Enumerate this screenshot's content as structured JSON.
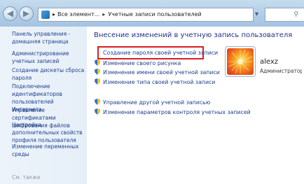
{
  "address_bar": {
    "crumbs": [
      "Все элемент...",
      "Учетные записи пользователей"
    ],
    "separator": "▸"
  },
  "left_nav": {
    "home": "Панель управления - домашняя страница",
    "links": [
      "Администрирование учетных записей",
      "Создание дискеты сброса пароля",
      "Подключение идентификаторов пользователей Интернета",
      "Управление сертификатами шифрования файлов",
      "Настройка дополнительных свойств профиля пользователя",
      "Изменение переменных среды"
    ],
    "see_also": "См. также"
  },
  "main": {
    "heading": "Внесение изменений в учетную запись пользователя",
    "tasks": [
      "Создание пароля своей учетной записи",
      "Изменение своего рисунка",
      "Изменение имени своей учетной записи",
      "Изменение типа своей учетной записи",
      "Управление другой учетной записью",
      "Изменение параметров контроля учетных записей"
    ]
  },
  "user": {
    "name": "alexz",
    "role": "Администратор"
  },
  "colors": {
    "link": "#1b3f8b",
    "heading": "#1e3287",
    "highlight_border": "#d81e24"
  }
}
